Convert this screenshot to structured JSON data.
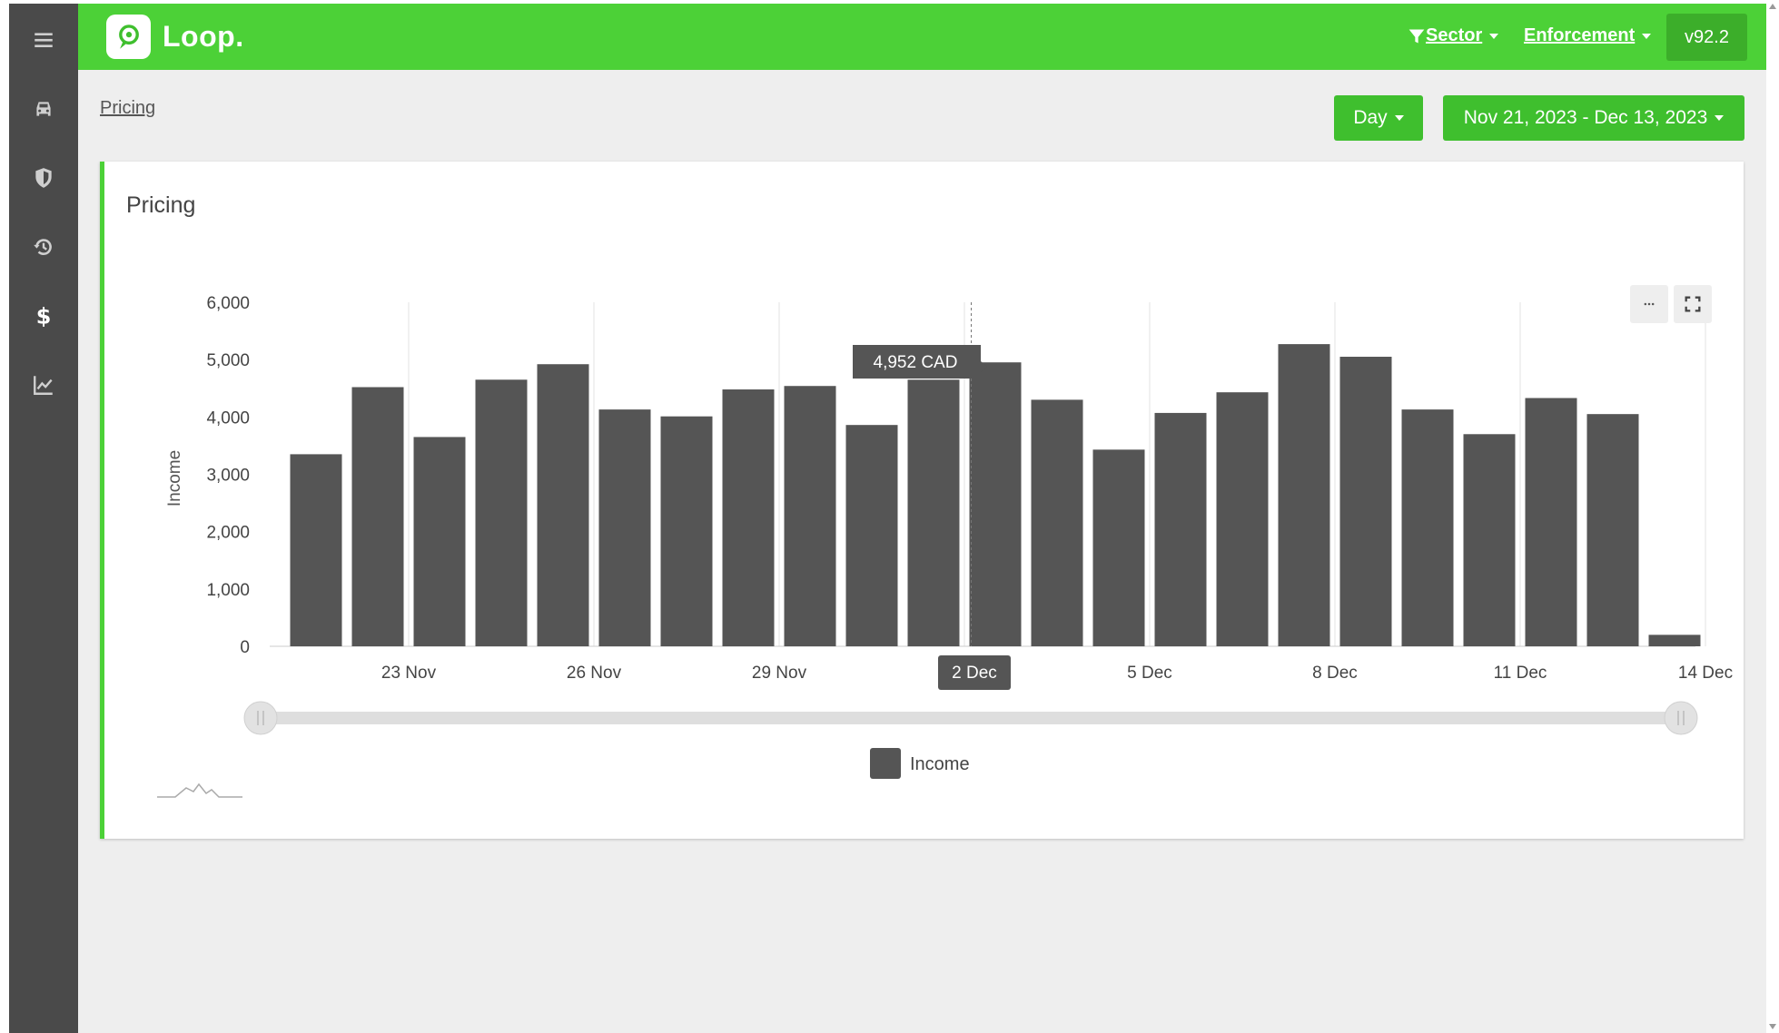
{
  "app": {
    "name": "Loop.",
    "version": "v92.2"
  },
  "sidebar": {
    "items": [
      {
        "icon": "menu-icon"
      },
      {
        "icon": "car-icon"
      },
      {
        "icon": "shield-icon"
      },
      {
        "icon": "history-icon"
      },
      {
        "icon": "dollar-icon",
        "active": true
      },
      {
        "icon": "chart-line-icon"
      }
    ]
  },
  "header": {
    "sector_label": "Sector",
    "enforcement_label": "Enforcement",
    "filter_icon": "filter-icon"
  },
  "breadcrumb": "Pricing",
  "toolbar": {
    "granularity": "Day",
    "date_range": "Nov 21, 2023 - Dec 13, 2023"
  },
  "card": {
    "title": "Pricing"
  },
  "tooltip": {
    "value_label": "4,952 CAD",
    "x_label": "2 Dec"
  },
  "legend": {
    "series_name": "Income",
    "color": "#555555"
  },
  "colors": {
    "brand": "#4cd137",
    "sidebar": "#4a4a4a",
    "bar": "#555555"
  },
  "chart_data": {
    "type": "bar",
    "ylabel": "Income",
    "ylim": [
      0,
      6000
    ],
    "yticks": [
      "0",
      "1,000",
      "2,000",
      "3,000",
      "4,000",
      "5,000",
      "6,000"
    ],
    "xtick_labels": [
      "23 Nov",
      "26 Nov",
      "29 Nov",
      "Dec",
      "5 Dec",
      "8 Dec",
      "11 Dec",
      "14 Dec"
    ],
    "categories": [
      "21 Nov",
      "22 Nov",
      "23 Nov",
      "24 Nov",
      "25 Nov",
      "26 Nov",
      "27 Nov",
      "28 Nov",
      "29 Nov",
      "30 Nov",
      "1 Dec",
      "2 Dec",
      "3 Dec",
      "4 Dec",
      "5 Dec",
      "6 Dec",
      "7 Dec",
      "8 Dec",
      "9 Dec",
      "10 Dec",
      "11 Dec",
      "12 Dec",
      "13 Dec"
    ],
    "series": [
      {
        "name": "Income",
        "values": [
          3350,
          4520,
          3650,
          4650,
          4920,
          4130,
          4010,
          4480,
          4540,
          3860,
          4650,
          4952,
          4300,
          3430,
          4070,
          4430,
          5270,
          5050,
          4130,
          3700,
          4330,
          4050,
          200
        ]
      }
    ],
    "highlight_index": 11,
    "grid": "vertical",
    "legend_position": "bottom"
  }
}
